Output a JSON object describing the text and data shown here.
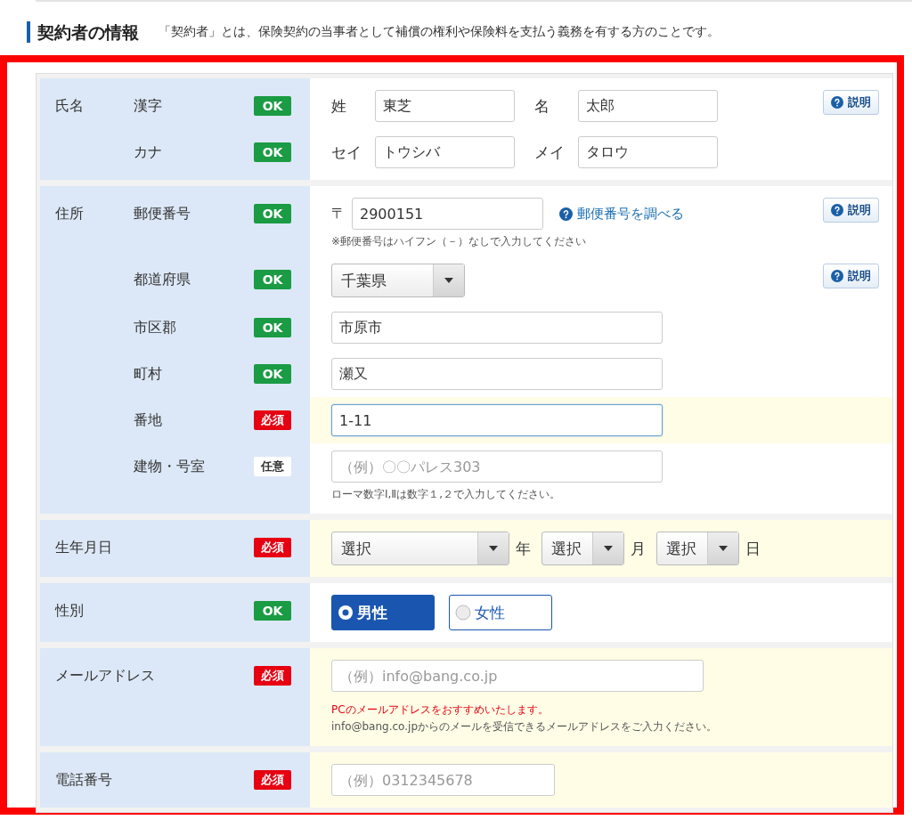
{
  "heading": {
    "title": "契約者の情報",
    "description": "「契約者」とは、保険契約の当事者として補償の権利や保険料を支払う義務を有する方のことです。"
  },
  "sections": [
    {
      "label": "氏名",
      "rows": [
        {
          "sublabel": "漢字",
          "badge": {
            "text": "OK",
            "kind": "ok"
          },
          "kind": "pair",
          "fields": [
            {
              "label": "姓",
              "value": "東芝"
            },
            {
              "label": "名",
              "value": "太郎"
            }
          ],
          "help": "説明"
        },
        {
          "sublabel": "カナ",
          "badge": {
            "text": "OK",
            "kind": "ok"
          },
          "kind": "pair",
          "fields": [
            {
              "label": "セイ",
              "value": "トウシバ"
            },
            {
              "label": "メイ",
              "value": "タロウ"
            }
          ]
        }
      ]
    },
    {
      "label": "住所",
      "rows": [
        {
          "sublabel": "郵便番号",
          "badge": {
            "text": "OK",
            "kind": "ok"
          },
          "kind": "postal",
          "prefix": "〒",
          "value": "2900151",
          "link": "郵便番号を調べる",
          "notes": [
            {
              "text": "※郵便番号はハイフン（－）なしで入力してください",
              "kind": "normal"
            }
          ],
          "help": "説明"
        },
        {
          "sublabel": "都道府県",
          "badge": {
            "text": "OK",
            "kind": "ok"
          },
          "kind": "select",
          "value": "千葉県",
          "help": "説明"
        },
        {
          "sublabel": "市区郡",
          "badge": {
            "text": "OK",
            "kind": "ok"
          },
          "kind": "text",
          "value": "市原市",
          "focused": false
        },
        {
          "sublabel": "町村",
          "badge": {
            "text": "OK",
            "kind": "ok"
          },
          "kind": "text",
          "value": "瀬又",
          "focused": false
        },
        {
          "sublabel": "番地",
          "badge": {
            "text": "必須",
            "kind": "required"
          },
          "kind": "text",
          "value": "1-11",
          "focused": true
        },
        {
          "sublabel": "建物・号室",
          "badge": {
            "text": "任意",
            "kind": "optional"
          },
          "kind": "text",
          "placeholder": "（例）〇〇パレス303",
          "focused": false,
          "notes": [
            {
              "text": "ローマ数字Ⅰ,Ⅱは数字１,２で入力してください。",
              "kind": "normal"
            }
          ]
        }
      ]
    },
    {
      "label": "生年月日",
      "rows": [
        {
          "badge": {
            "text": "必須",
            "kind": "required"
          },
          "kind": "date",
          "selects": [
            {
              "value": "選択",
              "unit": "年"
            },
            {
              "value": "選択",
              "unit": "月"
            },
            {
              "value": "選択",
              "unit": "日"
            }
          ]
        }
      ]
    },
    {
      "label": "性別",
      "rows": [
        {
          "badge": {
            "text": "OK",
            "kind": "ok"
          },
          "kind": "radio",
          "options": [
            {
              "label": "男性",
              "selected": true
            },
            {
              "label": "女性",
              "selected": false
            }
          ]
        }
      ]
    },
    {
      "label": "メールアドレス",
      "rows": [
        {
          "badge": {
            "text": "必須",
            "kind": "required"
          },
          "kind": "email",
          "placeholder": "（例）info@bang.co.jp",
          "focused": false,
          "notes": [
            {
              "text": "PCのメールアドレスをおすすめいたします。",
              "kind": "warning"
            },
            {
              "text": "info@bang.co.jpからのメールを受信できるメールアドレスをご入力ください。",
              "kind": "normal"
            }
          ]
        }
      ]
    },
    {
      "label": "電話番号",
      "rows": [
        {
          "badge": {
            "text": "必須",
            "kind": "required"
          },
          "kind": "phone",
          "placeholder": "（例）0312345678",
          "focused": false
        }
      ]
    }
  ]
}
